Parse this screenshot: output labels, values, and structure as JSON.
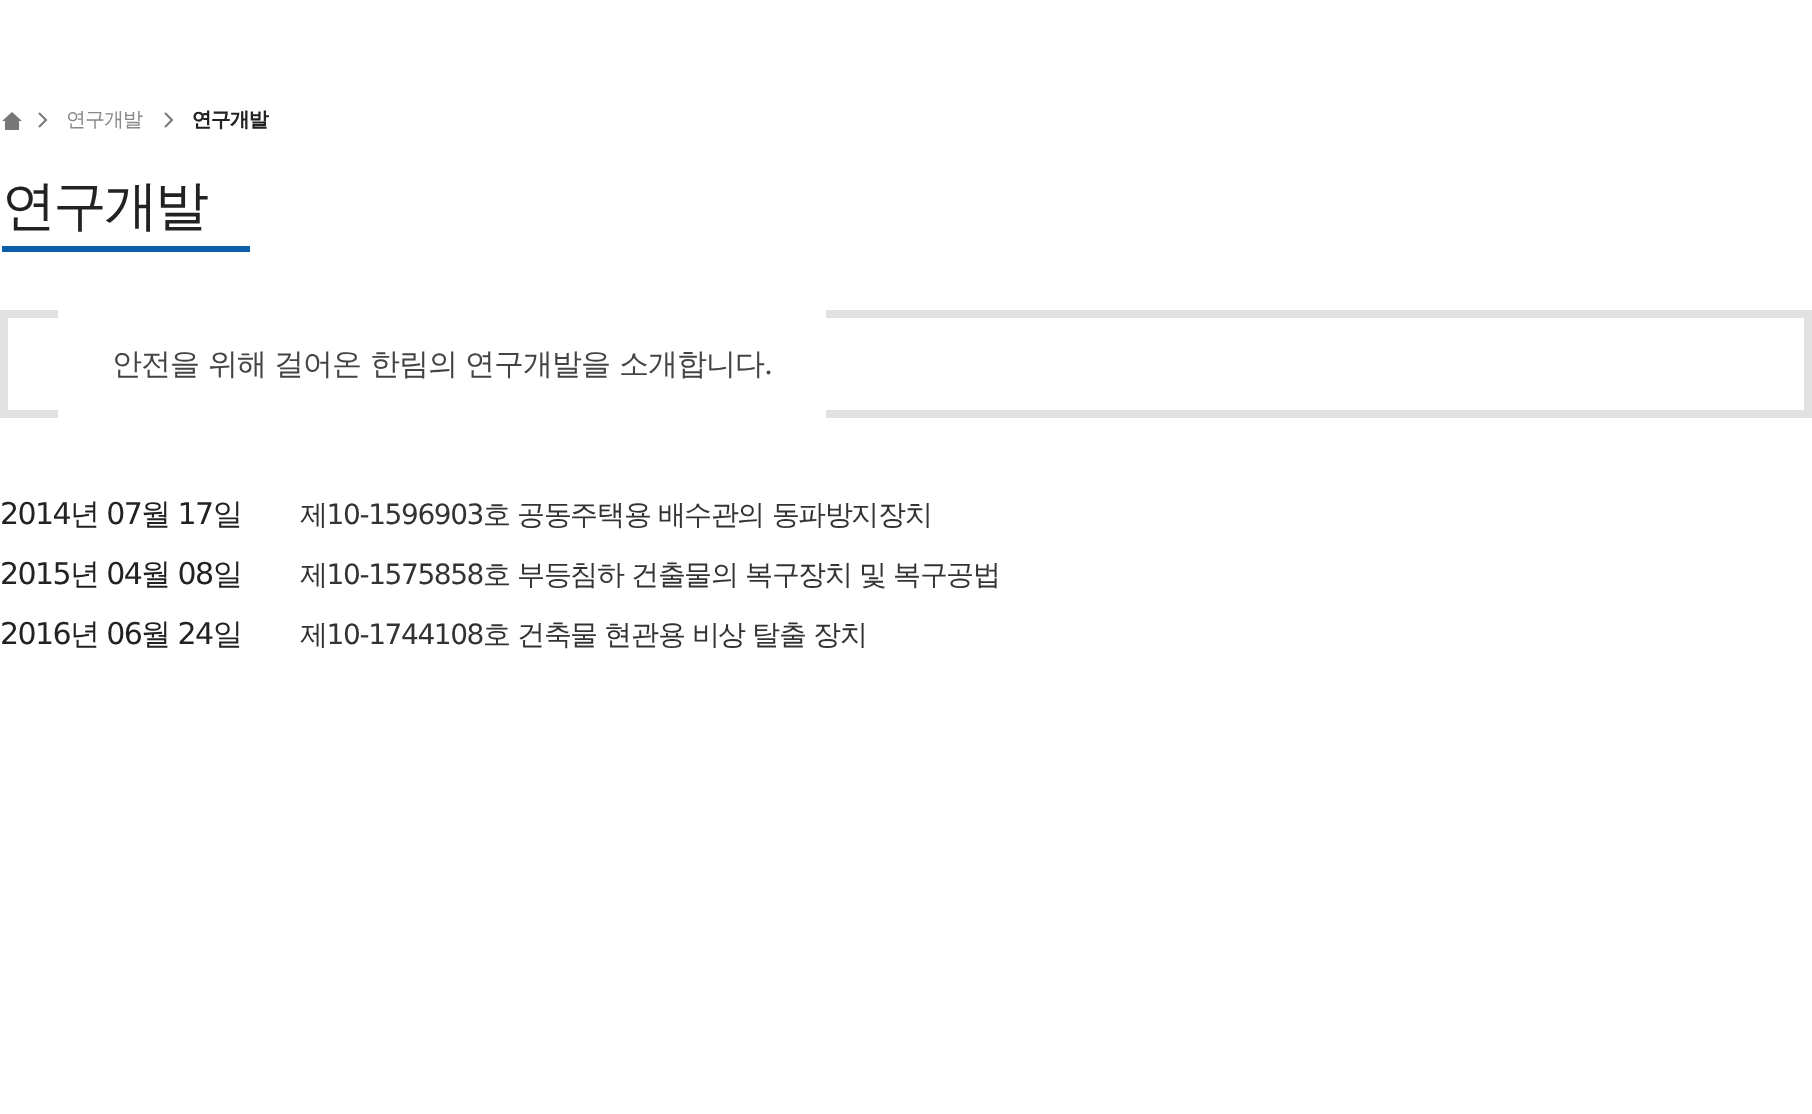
{
  "breadcrumb": [
    {
      "label": "연구개발",
      "selected": false
    },
    {
      "label": "연구개발",
      "selected": true
    }
  ],
  "page_title": "연구개발",
  "intro": "안전을 위해 걸어온 한림의 연구개발을 소개합니다.",
  "patents": [
    {
      "date": "2014년 07월 17일",
      "title": "제10-1596903호 공동주택용 배수관의 동파방지장치"
    },
    {
      "date": "2015년 04월 08일",
      "title": "제10-1575858호 부등침하 건출물의 복구장치 및 복구공법"
    },
    {
      "date": "2016년 06월 24일",
      "title": "제10-1744108호 건축물 현관용 비상 탈출 장치"
    }
  ]
}
